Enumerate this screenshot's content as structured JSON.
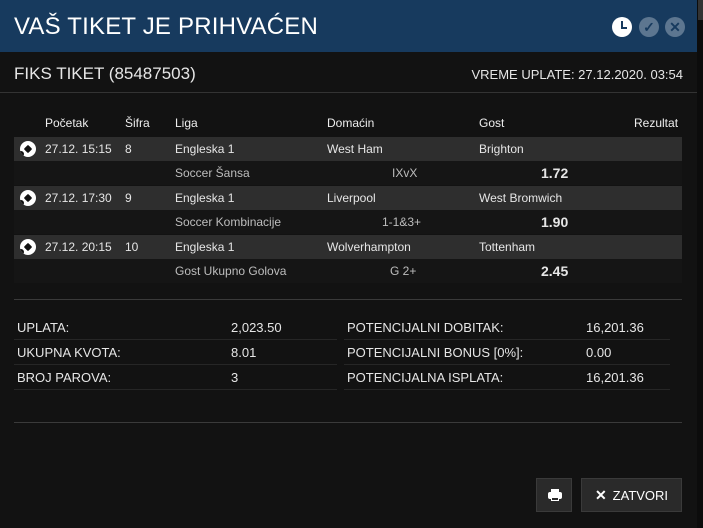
{
  "modal": {
    "title": "VAŠ TIKET JE PRIHVAĆEN",
    "ticket_label": "FIKS TIKET (85487503)",
    "time_label": "VREME UPLATE: 27.12.2020. 03:54"
  },
  "table": {
    "headers": [
      "Početak",
      "Šifra",
      "Liga",
      "Domaćin",
      "Gost",
      "Rezultat"
    ],
    "matches": [
      {
        "start": "27.12. 15:15",
        "code": "8",
        "league": "Engleska 1",
        "home": "West Ham",
        "away": "Brighton",
        "bet_type": "Soccer Šansa",
        "pick": "IXvX",
        "odd": "1.72"
      },
      {
        "start": "27.12. 17:30",
        "code": "9",
        "league": "Engleska 1",
        "home": "Liverpool",
        "away": "West Bromwich",
        "bet_type": "Soccer Kombinacije",
        "pick": "1-1&3+",
        "odd": "1.90"
      },
      {
        "start": "27.12. 20:15",
        "code": "10",
        "league": "Engleska 1",
        "home": "Wolverhampton",
        "away": "Tottenham",
        "bet_type": "Gost Ukupno Golova",
        "pick": "G 2+",
        "odd": "2.45"
      }
    ]
  },
  "summary": {
    "left": [
      {
        "label": "UPLATA:",
        "value": "2,023.50"
      },
      {
        "label": "UKUPNA KVOTA:",
        "value": "8.01"
      },
      {
        "label": "BROJ PAROVA:",
        "value": "3"
      }
    ],
    "right": [
      {
        "label": "POTENCIJALNI DOBITAK:",
        "value": "16,201.36"
      },
      {
        "label": "POTENCIJALNI BONUS [0%]:",
        "value": "0.00"
      },
      {
        "label": "POTENCIJALNA ISPLATA:",
        "value": "16,201.36"
      }
    ]
  },
  "buttons": {
    "close_label": "ZATVORI",
    "print_icon": "printer-icon",
    "close_icon": "close-icon"
  },
  "colors": {
    "titlebar": "#173a5e",
    "background": "#121212",
    "row_dark": "#2e2e2e"
  }
}
